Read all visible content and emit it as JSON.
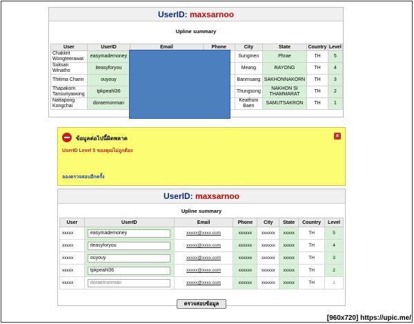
{
  "top_panel": {
    "userid_label": "UserID:",
    "userid_value": "maxsarnoo",
    "summary_title": "Upline summary",
    "columns": [
      "User",
      "UserID",
      "Email",
      "Phone",
      "City",
      "State",
      "Country",
      "Level"
    ],
    "rows": [
      {
        "user": "Chakkrit Wongteerawat",
        "userid": "easymademoney",
        "city": "Sungmen",
        "state": "Phrae",
        "country": "TH",
        "level": "5"
      },
      {
        "user": "Suksan Winatho",
        "userid": "iteasyforyou",
        "city": "Meang",
        "state": "RAYONG",
        "country": "TH",
        "level": "4"
      },
      {
        "user": "Thitima Charin",
        "userid": "ouyouy",
        "city": "Banmuang",
        "state": "SAKHONNAKORN",
        "country": "TH",
        "level": "3"
      },
      {
        "user": "Thapakorn Tansuriyawong",
        "userid": "tpkpeahl36",
        "city": "Thungsong",
        "state": "NAKHON SI THAMMARAT",
        "country": "TH",
        "level": "2"
      },
      {
        "user": "Nattapong Kongchai",
        "userid": "doraemonman",
        "city": "Keathum Baen",
        "state": "SAMUTSAKRON",
        "country": "TH",
        "level": "1"
      }
    ]
  },
  "error_box": {
    "title": "ข้อมูลต่อไปนี้ผิดพลาด",
    "message": "UserID Level 5 ของคุณไม่ถูกต้อง",
    "retry_link": "ลองตรวจสอบอีกครั้ง",
    "close_glyph": "×",
    "colors": {
      "background": "#fdfd73",
      "icon": "#c81c1c",
      "message": "#c41e1e"
    }
  },
  "bottom_panel": {
    "userid_label": "UserID:",
    "userid_value": "maxsarnoo",
    "summary_title": "Upline summary",
    "columns": [
      "User",
      "UserID",
      "Email",
      "Phone",
      "City",
      "State",
      "Country",
      "Level"
    ],
    "rows": [
      {
        "user": "xxxxx",
        "userid": "easymademoney",
        "email": "xxxxx@xxxx.com",
        "phone": "xxxxxx",
        "city": "xxxxxx",
        "state": "xxxxx",
        "country": "TH",
        "level": "5"
      },
      {
        "user": "xxxxx",
        "userid": "iteasyforyou",
        "email": "xxxxx@xxxx.com",
        "phone": "xxxxxx",
        "city": "xxxxxx",
        "state": "xxxxx",
        "country": "TH",
        "level": "4"
      },
      {
        "user": "xxxxx",
        "userid": "ouyouy",
        "email": "xxxxx@xxxx.com",
        "phone": "xxxxxx",
        "city": "xxxxxx",
        "state": "xxxxx",
        "country": "TH",
        "level": "3"
      },
      {
        "user": "xxxxx",
        "userid": "tpkpeahl36",
        "email": "xxxxx@xxxx.com",
        "phone": "xxxxxx",
        "city": "xxxxxx",
        "state": "xxxxx",
        "country": "TH",
        "level": "2"
      },
      {
        "user": "xxxxx",
        "userid_placeholder": "doraemonman",
        "email": "xxxxx@xxxx.com",
        "phone": "xxxxxx",
        "city": "xxxxxx",
        "state": "xxxxx",
        "country": "TH",
        "level": "1"
      }
    ],
    "check_button": "ตรวจสอบข้อมูล"
  },
  "watermark": "[960x720] https://upic.me/",
  "colors": {
    "title_label": "#0a2a7a",
    "title_value": "#cc0000",
    "green_cell": "#d8f0d8",
    "redaction": "#4b7fbd"
  }
}
